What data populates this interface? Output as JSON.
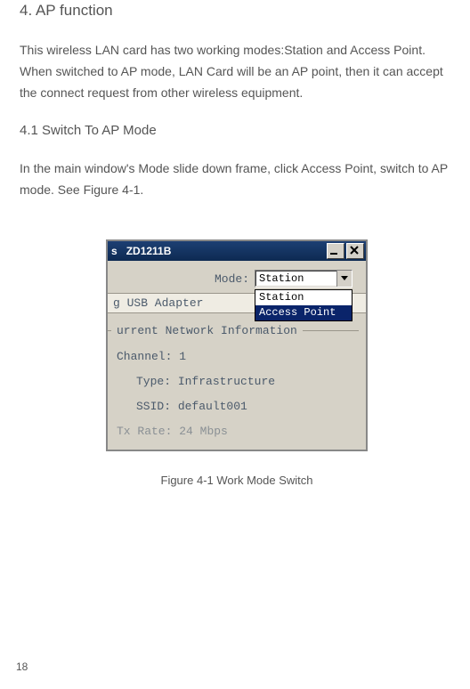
{
  "section_title": "4. AP function",
  "paragraph1": "This wireless LAN card has two working modes:Station and Access Point. When switched to AP mode, LAN Card will be an AP point, then it can accept the connect request from other wireless equipment.",
  "subsection_title": "4.1 Switch To AP Mode",
  "paragraph2": "In the main window's Mode slide down frame, click Access Point, switch to AP mode. See Figure 4-1.",
  "window": {
    "title_prefix": "s",
    "device": "ZD1211B",
    "mode_label": "Mode:",
    "combo_value": "Station",
    "options": {
      "station": "Station",
      "access_point": "Access Point"
    },
    "adapter_text": "g USB Adapter",
    "group_title": "urrent Network Information",
    "channel_label": "Channel:",
    "channel_value": "1",
    "type_label": "Type:",
    "type_value": "Infrastructure",
    "ssid_label": "SSID:",
    "ssid_value": "default001",
    "tx_label": "Tx Rate:",
    "tx_value": "24 Mbps"
  },
  "figure_caption": "Figure 4-1 Work Mode Switch",
  "page_number": "18"
}
